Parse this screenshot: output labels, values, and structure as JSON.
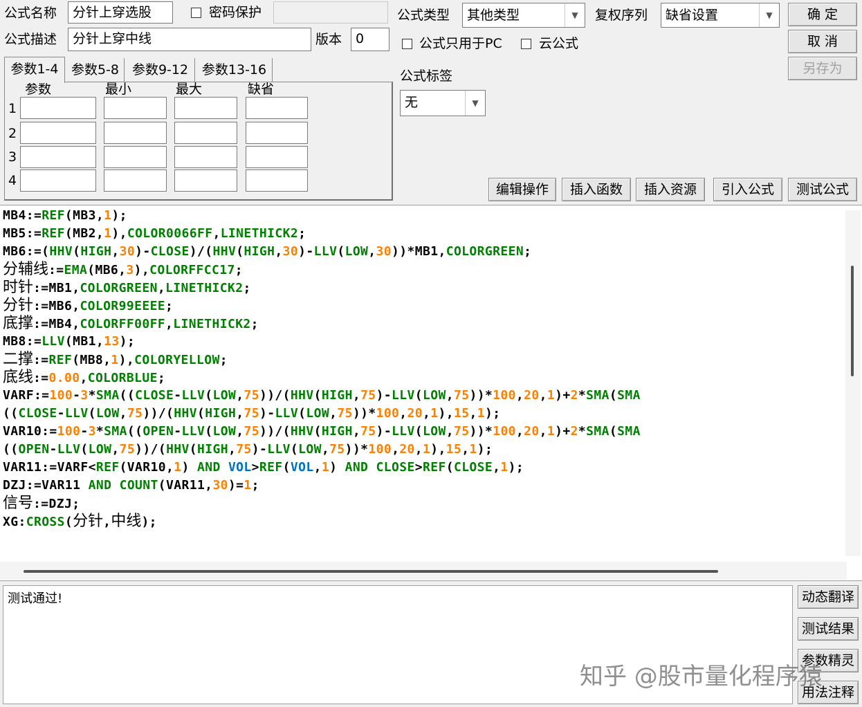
{
  "header": {
    "name_label": "公式名称",
    "name_value": "分针上穿选股",
    "password_label": "密码保护",
    "desc_label": "公式描述",
    "desc_value": "分针上穿中线",
    "version_label": "版本",
    "version_value": "0",
    "type_label": "公式类型",
    "type_value": "其他类型",
    "rights_label": "复权序列",
    "rights_value": "缺省设置",
    "pc_only_label": "公式只用于PC",
    "cloud_label": "云公式",
    "tag_label": "公式标签",
    "tag_value": "无"
  },
  "buttons": {
    "ok": "确 定",
    "cancel": "取 消",
    "save_as": "另存为",
    "edit_ops": "编辑操作",
    "insert_func": "插入函数",
    "insert_res": "插入资源",
    "import_formula": "引入公式",
    "test_formula": "测试公式",
    "dynamic_translate": "动态翻译",
    "test_result": "测试结果",
    "param_wizard": "参数精灵",
    "usage_notes": "用法注释"
  },
  "tabs": [
    "参数1-4",
    "参数5-8",
    "参数9-12",
    "参数13-16"
  ],
  "param_table": {
    "headers": [
      "参数",
      "最小",
      "最大",
      "缺省"
    ],
    "rows": [
      "1",
      "2",
      "3",
      "4"
    ]
  },
  "code_lines": [
    "MB4:=REF(MB3,1);",
    "MB5:=REF(MB2,1),COLOR0066FF,LINETHICK2;",
    "MB6:=(HHV(HIGH,30)-CLOSE)/(HHV(HIGH,30)-LLV(LOW,30))*MB1,COLORGREEN;",
    "分辅线:=EMA(MB6,3),COLORFFCC17;",
    "时针:=MB1,COLORGREEN,LINETHICK2;",
    "分针:=MB6,COLOR99EEEE;",
    "底撑:=MB4,COLORFF00FF,LINETHICK2;",
    "MB8:=LLV(MB1,13);",
    "二撑:=REF(MB8,1),COLORYELLOW;",
    "底线:=0.00,COLORBLUE;",
    "VARF:=100-3*SMA((CLOSE-LLV(LOW,75))/(HHV(HIGH,75)-LLV(LOW,75))*100,20,1)+2*SMA(SMA",
    "((CLOSE-LLV(LOW,75))/(HHV(HIGH,75)-LLV(LOW,75))*100,20,1),15,1);",
    "VAR10:=100-3*SMA((OPEN-LLV(LOW,75))/(HHV(HIGH,75)-LLV(LOW,75))*100,20,1)+2*SMA(SMA",
    "((OPEN-LLV(LOW,75))/(HHV(HIGH,75)-LLV(LOW,75))*100,20,1),15,1);",
    "VAR11:=VARF<REF(VAR10,1) AND VOL>REF(VOL,1) AND CLOSE>REF(CLOSE,1);",
    "DZJ:=VAR11 AND COUNT(VAR11,30)=1;",
    "信号:=DZJ;",
    "XG:CROSS(分针,中线);"
  ],
  "output_text": "测试通过!",
  "watermark": "知乎 @股市量化程序猿"
}
